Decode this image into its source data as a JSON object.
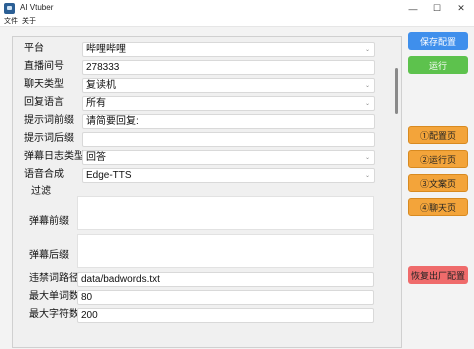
{
  "window": {
    "title": "AI Vtuber",
    "minimize": "—",
    "maximize": "☐",
    "close": "✕"
  },
  "menu": [
    "文件",
    "关于"
  ],
  "form": {
    "platform": {
      "label": "平台",
      "value": "哔哩哔哩"
    },
    "room": {
      "label": "直播间号",
      "value": "278333"
    },
    "chat_type": {
      "label": "聊天类型",
      "value": "复读机"
    },
    "reply_lang": {
      "label": "回复语言",
      "value": "所有"
    },
    "prompt_prefix": {
      "label": "提示词前缀",
      "value": "请简要回复:"
    },
    "prompt_suffix": {
      "label": "提示词后缀",
      "value": ""
    },
    "danmaku_log_type": {
      "label": "弹幕日志类型",
      "value": "回答"
    },
    "tts": {
      "label": "语音合成",
      "value": "Edge-TTS"
    },
    "filter": {
      "title": "过滤",
      "danmaku_prefix_label": "弹幕前缀",
      "danmaku_suffix_label": "弹幕后缀"
    },
    "badwords": {
      "label": "违禁词路径",
      "value": "data/badwords.txt"
    },
    "max_words": {
      "label": "最大单词数",
      "value": "80"
    },
    "max_chars": {
      "label": "最大字符数",
      "value": "200"
    }
  },
  "buttons": {
    "save": "保存配置",
    "run": "运行",
    "page1": "①配置页",
    "page2": "②运行页",
    "page3": "③文案页",
    "page4": "④聊天页",
    "reset": "恢复出厂配置"
  }
}
